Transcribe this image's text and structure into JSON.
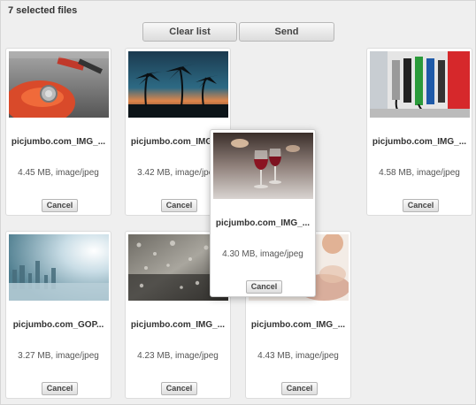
{
  "header": {
    "selected_count": "7 selected files"
  },
  "toolbar": {
    "clear_label": "Clear list",
    "send_label": "Send"
  },
  "files": [
    {
      "name": "picjumbo.com_IMG_...",
      "meta": "4.45 MB, image/jpeg",
      "cancel": "Cancel",
      "thumb": "motorcycle-tank"
    },
    {
      "name": "picjumbo.com_IMG_...",
      "meta": "3.42 MB, image/jpeg",
      "cancel": "Cancel",
      "thumb": "palm-sunset"
    },
    {
      "name": "picjumbo.com_IMG_...",
      "meta": "4.30 MB, image/jpeg",
      "cancel": "Cancel",
      "thumb": "wine-glasses"
    },
    {
      "name": "picjumbo.com_IMG_...",
      "meta": "4.58 MB, image/jpeg",
      "cancel": "Cancel",
      "thumb": "fuel-pumps"
    },
    {
      "name": "picjumbo.com_GOP...",
      "meta": "3.27 MB, image/jpeg",
      "cancel": "Cancel",
      "thumb": "foggy-city"
    },
    {
      "name": "picjumbo.com_IMG_...",
      "meta": "4.23 MB, image/jpeg",
      "cancel": "Cancel",
      "thumb": "rain-window"
    },
    {
      "name": "picjumbo.com_IMG_...",
      "meta": "4.43 MB, image/jpeg",
      "cancel": "Cancel",
      "thumb": "blurred-food"
    }
  ]
}
